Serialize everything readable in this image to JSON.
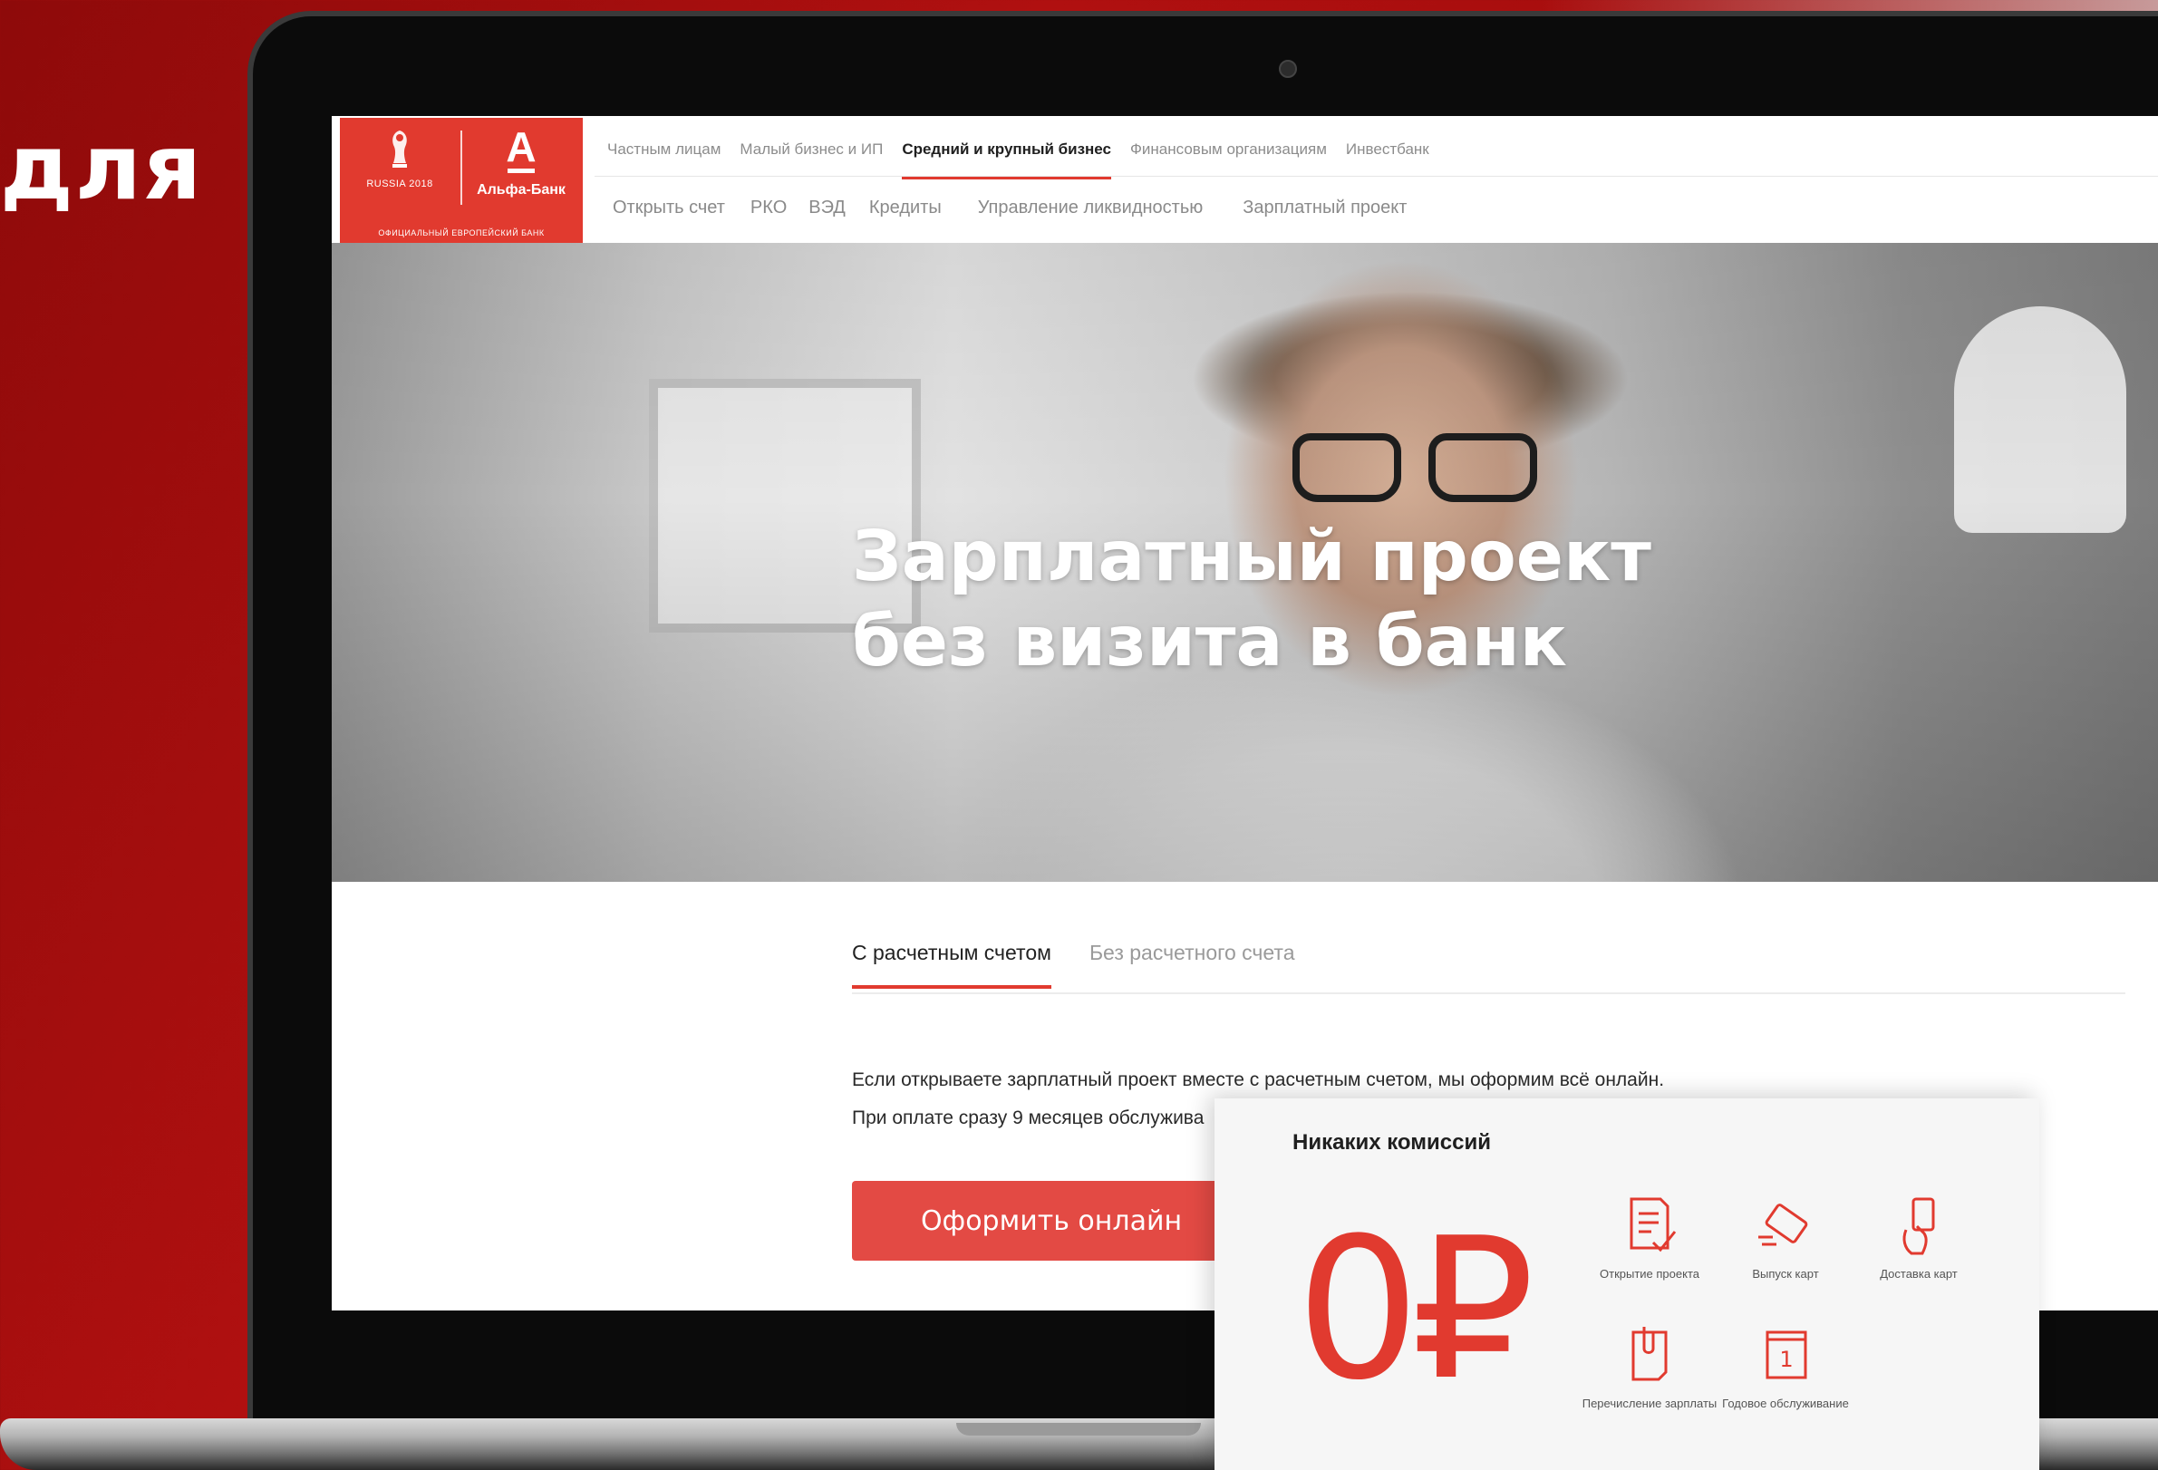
{
  "slide": {
    "title": "для"
  },
  "logo": {
    "event_text": "RUSSIA 2018",
    "bank_letter": "А",
    "bank_name": "Альфа-Банк",
    "caption": "ОФИЦИАЛЬНЫЙ ЕВРОПЕЙСКИЙ БАНК"
  },
  "nav": {
    "top": [
      {
        "label": "Частным лицам",
        "active": false
      },
      {
        "label": "Малый бизнес и ИП",
        "active": false
      },
      {
        "label": "Средний и крупный бизнес",
        "active": true
      },
      {
        "label": "Финансовым организациям",
        "active": false
      },
      {
        "label": "Инвестбанк",
        "active": false
      }
    ],
    "sub": [
      "Открыть счет",
      "РКО",
      "ВЭД",
      "Кредиты",
      "Управление ликвидностью",
      "Зарплатный проект"
    ]
  },
  "hero": {
    "title_line1": "Зарплатный проект",
    "title_line2": "без визита в банк"
  },
  "tabs": [
    {
      "label": "С расчетным счетом",
      "active": true
    },
    {
      "label": "Без расчетного счета",
      "active": false
    }
  ],
  "body": {
    "line1": "Если открываете зарплатный проект вместе с расчетным счетом, мы оформим всё онлайн.",
    "line2": "При оплате сразу 9 месяцев обслужива"
  },
  "cta": {
    "label": "Оформить онлайн"
  },
  "card": {
    "title": "Никаких комиссий",
    "price": "0₽",
    "features": [
      {
        "icon": "document-check-icon",
        "label": "Открытие проекта"
      },
      {
        "icon": "card-issue-icon",
        "label": "Выпуск карт"
      },
      {
        "icon": "card-delivery-icon",
        "label": "Доставка карт"
      },
      {
        "icon": "salary-transfer-icon",
        "label": "Перечисление зарплаты"
      },
      {
        "icon": "calendar-icon",
        "label": "Годовое обслуживание"
      }
    ]
  },
  "colors": {
    "brand_red": "#e13a2f",
    "button_red": "#e34a44",
    "background_red": "#a30c0c"
  }
}
